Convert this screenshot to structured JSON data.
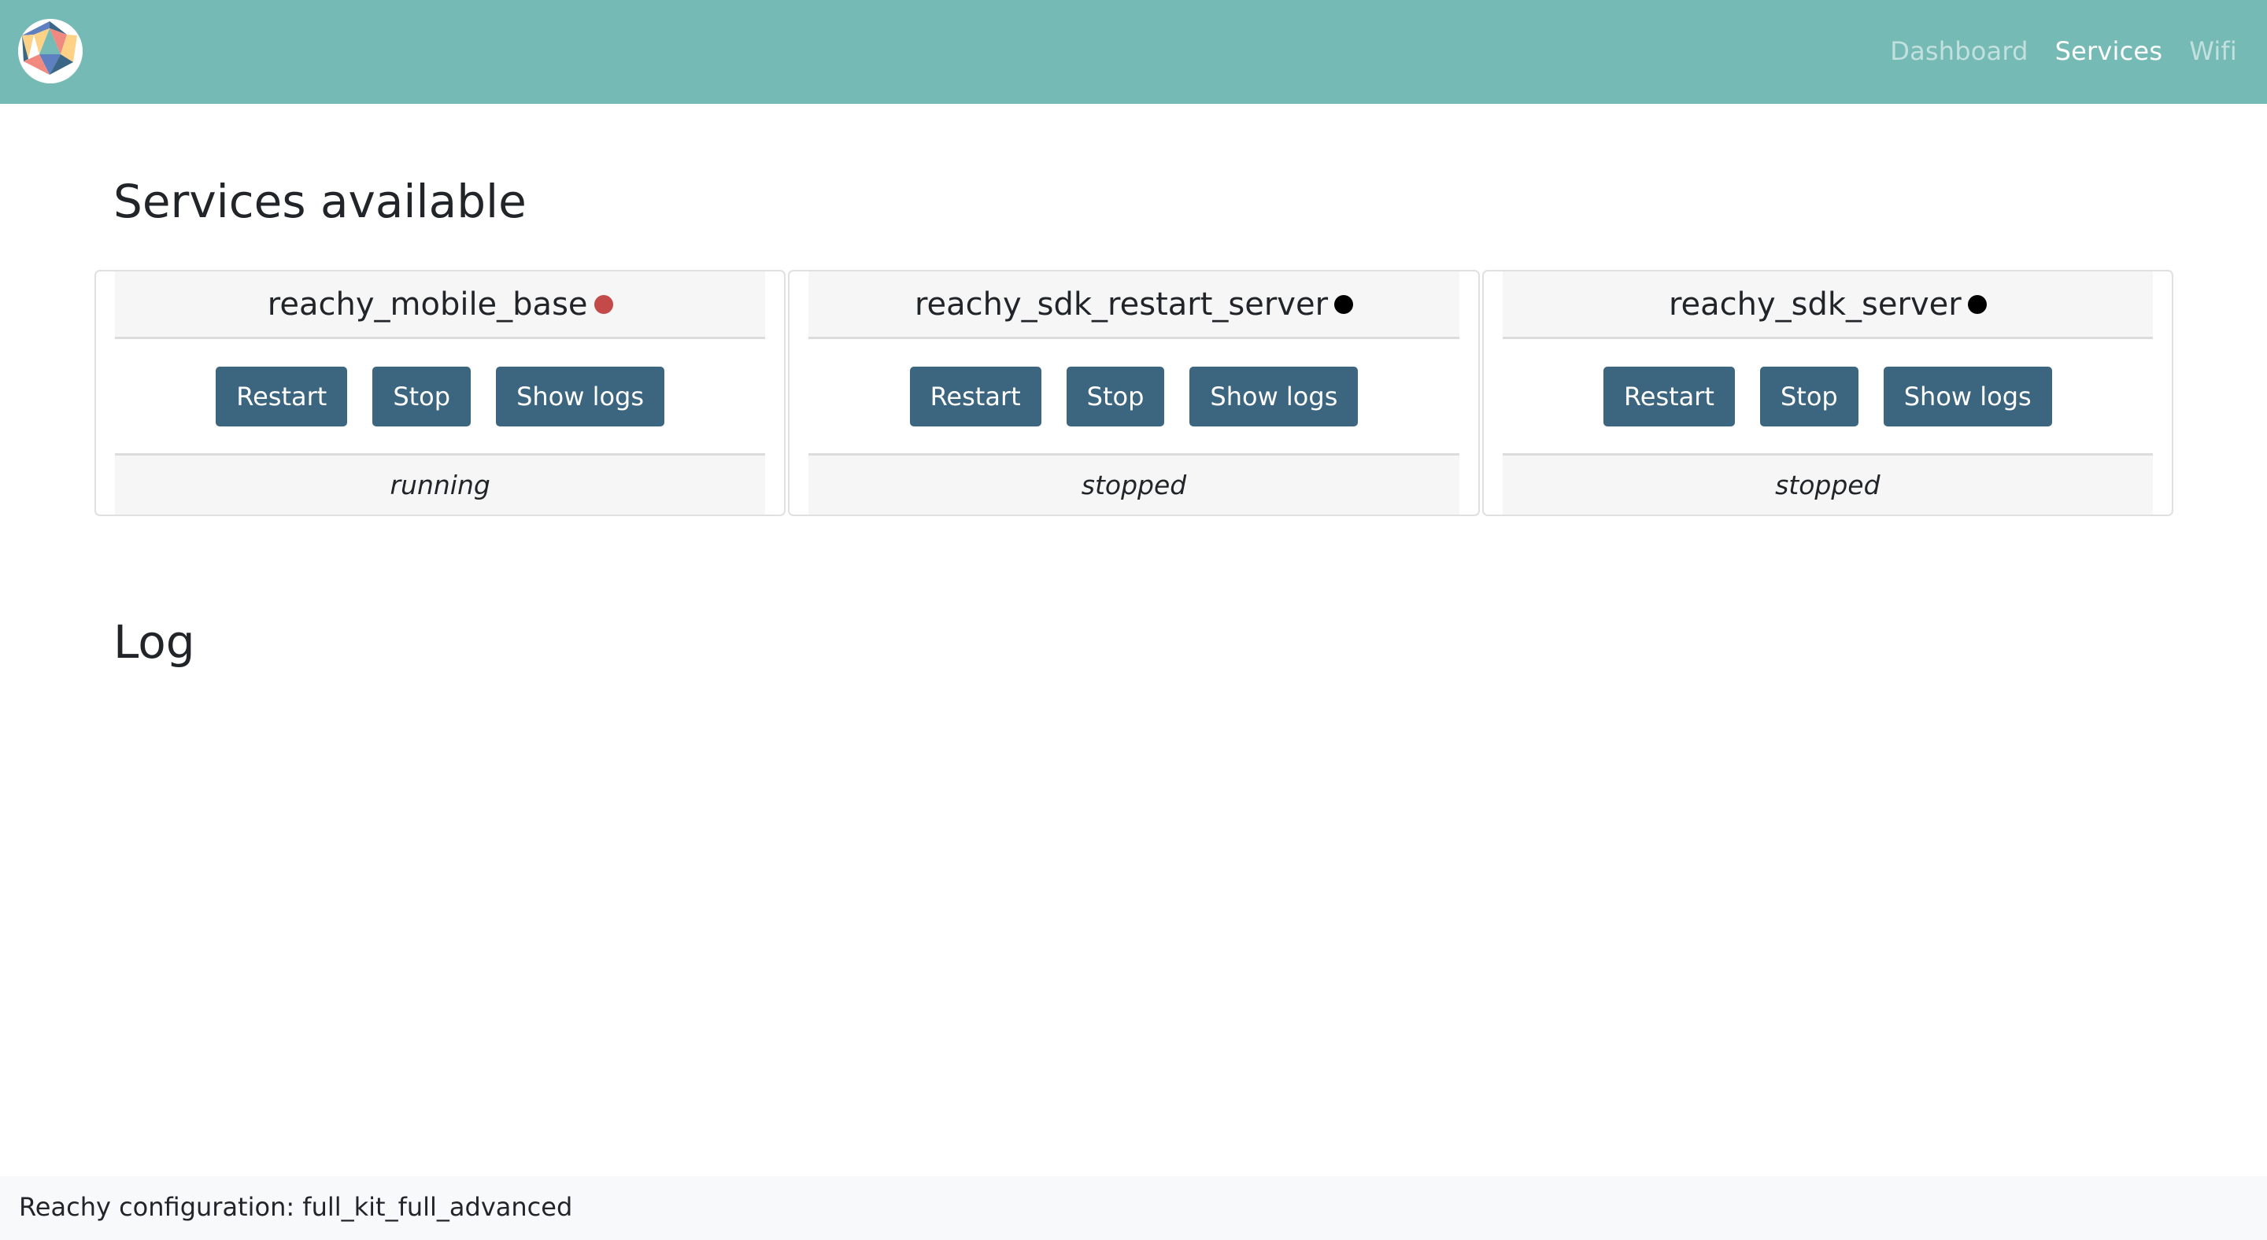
{
  "navbar": {
    "logo_icon": "reachy-polyhedron-logo",
    "links": [
      {
        "label": "Dashboard",
        "active": false
      },
      {
        "label": "Services",
        "active": true
      },
      {
        "label": "Wifi",
        "active": false
      }
    ],
    "background_color": "#76bab6"
  },
  "services_section": {
    "title": "Services available",
    "services": [
      {
        "name": "reachy_mobile_base",
        "status_dot_color": "#c44a4a",
        "buttons": {
          "restart": "Restart",
          "stop": "Stop",
          "show_logs": "Show logs"
        },
        "status": "running"
      },
      {
        "name": "reachy_sdk_restart_server",
        "status_dot_color": "#000000",
        "buttons": {
          "restart": "Restart",
          "stop": "Stop",
          "show_logs": "Show logs"
        },
        "status": "stopped"
      },
      {
        "name": "reachy_sdk_server",
        "status_dot_color": "#000000",
        "buttons": {
          "restart": "Restart",
          "stop": "Stop",
          "show_logs": "Show logs"
        },
        "status": "stopped"
      }
    ],
    "button_color": "#3c6680"
  },
  "log_section": {
    "title": "Log"
  },
  "footer": {
    "text": "Reachy configuration: full_kit_full_advanced"
  }
}
